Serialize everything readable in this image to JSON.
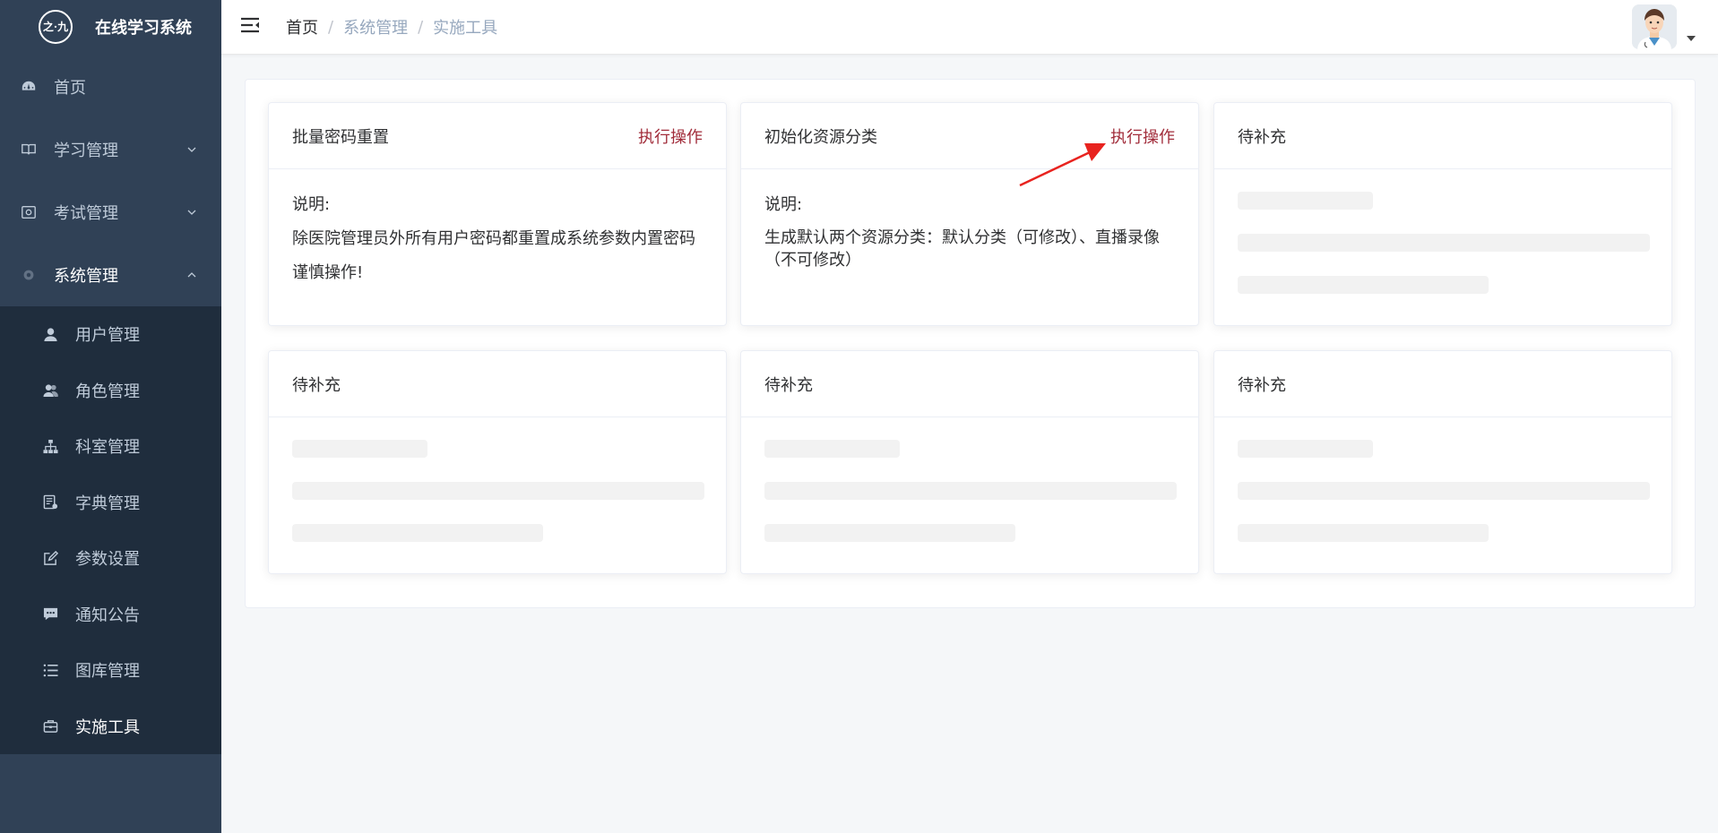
{
  "app": {
    "logo_mark": "之·九",
    "title": "在线学习系统"
  },
  "sidebar": {
    "items": [
      {
        "label": "首页",
        "icon": "dashboard-icon"
      },
      {
        "label": "学习管理",
        "icon": "book-icon"
      },
      {
        "label": "考试管理",
        "icon": "exam-icon"
      },
      {
        "label": "系统管理",
        "icon": "gear-icon"
      }
    ],
    "sub_items": [
      {
        "label": "用户管理",
        "icon": "user-icon"
      },
      {
        "label": "角色管理",
        "icon": "users-icon"
      },
      {
        "label": "科室管理",
        "icon": "sitemap-icon"
      },
      {
        "label": "字典管理",
        "icon": "dictionary-icon"
      },
      {
        "label": "参数设置",
        "icon": "edit-icon"
      },
      {
        "label": "通知公告",
        "icon": "message-icon"
      },
      {
        "label": "图库管理",
        "icon": "list-icon"
      },
      {
        "label": "实施工具",
        "icon": "toolbox-icon"
      }
    ]
  },
  "header": {
    "breadcrumb": [
      "首页",
      "系统管理",
      "实施工具"
    ],
    "separator": "/"
  },
  "cards": [
    {
      "title": "批量密码重置",
      "action": "执行操作",
      "desc_label": "说明:",
      "lines": [
        "除医院管理员外所有用户密码都重置成系统参数内置密码",
        "谨慎操作!"
      ]
    },
    {
      "title": "初始化资源分类",
      "action": "执行操作",
      "desc_label": "说明:",
      "lines": [
        "生成默认两个资源分类：默认分类（可修改）、直播录像（不可修改）"
      ]
    },
    {
      "title": "待补充"
    },
    {
      "title": "待补充"
    },
    {
      "title": "待补充"
    },
    {
      "title": "待补充"
    }
  ],
  "colors": {
    "sidebar_bg": "#304156",
    "submenu_bg": "#1f2d3d",
    "action_red": "#a12c3a",
    "annotation_arrow": "#e8231f"
  }
}
